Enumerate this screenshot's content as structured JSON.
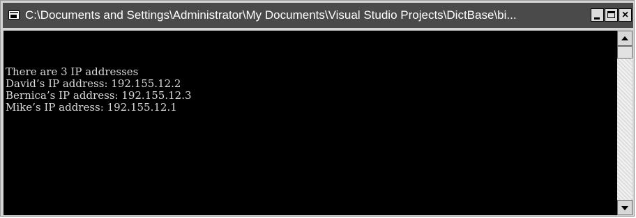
{
  "window": {
    "title": "C:\\Documents and Settings\\Administrator\\My Documents\\Visual Studio Projects\\DictBase\\bi...",
    "app_icon": "console-window-icon",
    "controls": {
      "minimize_icon": "minimize-icon",
      "maximize_icon": "maximize-icon",
      "close_icon": "close-icon",
      "close_glyph": "×"
    }
  },
  "console": {
    "lines": [
      "There are 3 IP addresses",
      "David’s IP address: 192.155.12.2",
      "Bernica’s IP address: 192.155.12.3",
      "Mike’s IP address: 192.155.12.1"
    ],
    "background": "#000000",
    "foreground": "#d8d8d8"
  },
  "scrollbar": {
    "up_icon": "arrow-up-icon",
    "down_icon": "arrow-down-icon"
  }
}
